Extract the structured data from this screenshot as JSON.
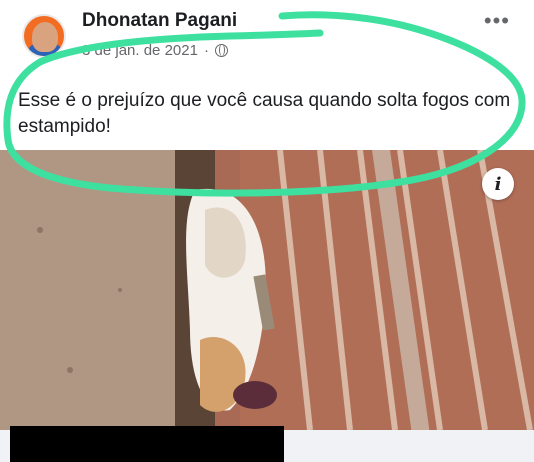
{
  "post": {
    "author": "Dhonatan Pagani",
    "date": "3 de jan. de 2021",
    "separator": "·",
    "more_label": "•••",
    "text": "Esse é o prejuízo que você causa quando solta fogos com estampido!",
    "privacy_icon": "globe-icon"
  },
  "photo": {
    "info_label": "i"
  },
  "colors": {
    "highlight": "#3ee0a0",
    "text": "#1c1e21",
    "meta": "#65676b"
  }
}
